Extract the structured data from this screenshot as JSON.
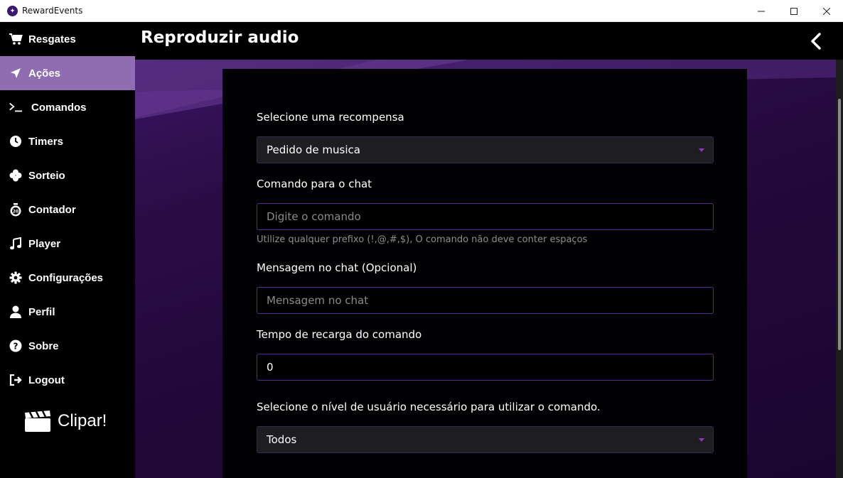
{
  "window": {
    "title": "RewardEvents"
  },
  "sidebar": {
    "items": [
      {
        "label": "Resgates",
        "icon": "cart-icon"
      },
      {
        "label": "Ações",
        "icon": "location-arrow-icon",
        "active": true
      },
      {
        "label": "Comandos",
        "icon": "terminal-icon"
      },
      {
        "label": "Timers",
        "icon": "clock-icon"
      },
      {
        "label": "Sorteio",
        "icon": "clover-icon"
      },
      {
        "label": "Contador",
        "icon": "stopwatch-icon"
      },
      {
        "label": "Player",
        "icon": "music-icon"
      },
      {
        "label": "Configurações",
        "icon": "gear-icon"
      },
      {
        "label": "Perfil",
        "icon": "user-icon"
      },
      {
        "label": "Sobre",
        "icon": "question-icon"
      },
      {
        "label": "Logout",
        "icon": "logout-icon"
      }
    ],
    "clip_label": "Clipar!"
  },
  "header": {
    "title": "Reproduzir audio"
  },
  "form": {
    "reward_label": "Selecione uma recompensa",
    "reward_value": "Pedido de musica",
    "command_label": "Comando para o chat",
    "command_placeholder": "Digite o comando",
    "command_hint": "Utilize qualquer prefixo (!,@,#,$), O comando não deve conter espaços",
    "message_label": "Mensagem no chat (Opcional)",
    "message_placeholder": "Mensagem no chat",
    "cooldown_label": "Tempo de recarga do comando",
    "cooldown_value": "0",
    "level_label": "Selecione o nível de usuário necessário para utilizar o comando.",
    "level_value": "Todos"
  },
  "colors": {
    "accent": "#8f6db0",
    "border": "#5a2a8a",
    "caret": "#8c38c8"
  }
}
